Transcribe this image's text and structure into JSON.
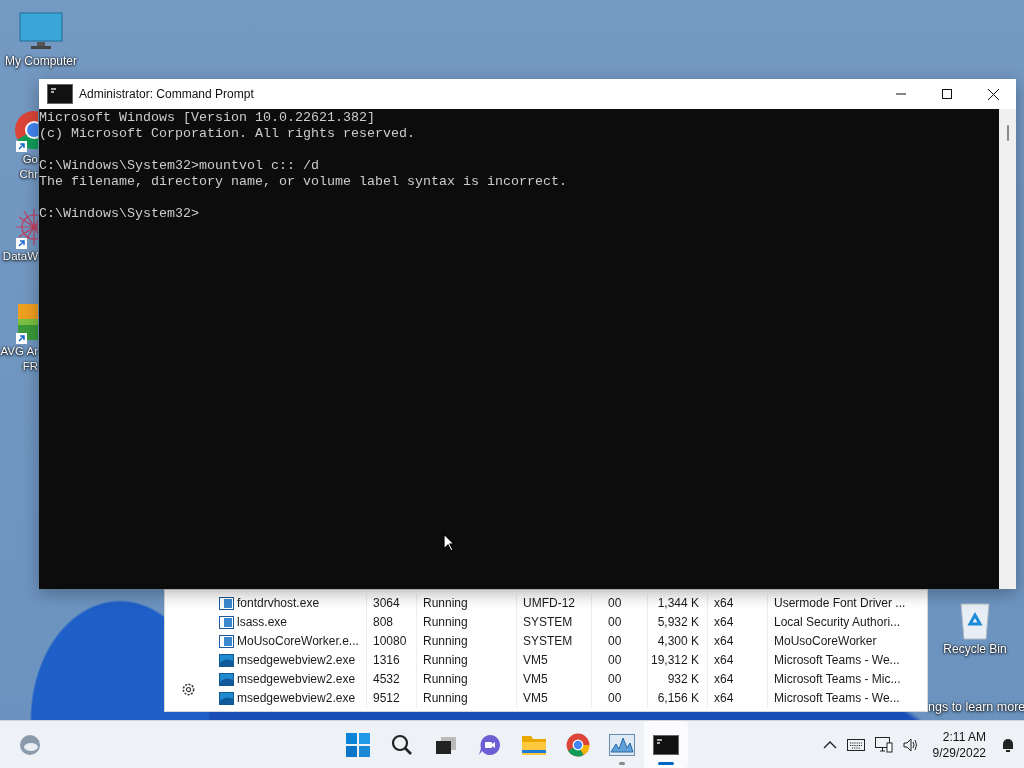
{
  "desktop_icons": [
    {
      "kind": "computer",
      "label_lines": [
        "My Computer"
      ],
      "shortcut": false
    },
    {
      "kind": "chrome",
      "label_lines": [
        "Go",
        "Chr"
      ],
      "shortcut": true
    },
    {
      "kind": "network",
      "label_lines": [
        "DataW"
      ],
      "shortcut": true
    },
    {
      "kind": "avg",
      "label_lines": [
        "AVG Ar",
        "FR"
      ],
      "shortcut": true
    }
  ],
  "recycle_bin": {
    "label": "Recycle Bin"
  },
  "activation_text": "ngs to learn more",
  "task_manager": {
    "rows": [
      {
        "kind": "service",
        "name": "fontdrvhost.exe",
        "pid": "3064",
        "status": "Running",
        "user": "UMFD-12",
        "cpu": "00",
        "memory": "1,344 K",
        "arch": "x64",
        "description": "Usermode Font Driver ..."
      },
      {
        "kind": "service",
        "name": "lsass.exe",
        "pid": "808",
        "status": "Running",
        "user": "SYSTEM",
        "cpu": "00",
        "memory": "5,932 K",
        "arch": "x64",
        "description": "Local Security Authori..."
      },
      {
        "kind": "service",
        "name": "MoUsoCoreWorker.e...",
        "pid": "10080",
        "status": "Running",
        "user": "SYSTEM",
        "cpu": "00",
        "memory": "4,300 K",
        "arch": "x64",
        "description": "MoUsoCoreWorker"
      },
      {
        "kind": "webview",
        "name": "msedgewebview2.exe",
        "pid": "1316",
        "status": "Running",
        "user": "VM5",
        "cpu": "00",
        "memory": "19,312 K",
        "arch": "x64",
        "description": "Microsoft Teams - We..."
      },
      {
        "kind": "webview",
        "name": "msedgewebview2.exe",
        "pid": "4532",
        "status": "Running",
        "user": "VM5",
        "cpu": "00",
        "memory": "932 K",
        "arch": "x64",
        "description": "Microsoft Teams - Mic..."
      },
      {
        "kind": "webview",
        "name": "msedgewebview2.exe",
        "pid": "9512",
        "status": "Running",
        "user": "VM5",
        "cpu": "00",
        "memory": "6,156 K",
        "arch": "x64",
        "description": "Microsoft Teams - We..."
      }
    ]
  },
  "console_window": {
    "title": "Administrator: Command Prompt",
    "blocks": [
      [
        "Microsoft Windows [Version 10.0.22621.382]",
        "(c) Microsoft Corporation. All rights reserved."
      ],
      [
        "C:\\Windows\\System32>mountvol c:: /d",
        "The filename, directory name, or volume label syntax is incorrect."
      ],
      [
        "C:\\Windows\\System32>"
      ]
    ]
  },
  "taskbar": {
    "apps": [
      {
        "kind": "start",
        "running": false,
        "selected": false
      },
      {
        "kind": "search",
        "running": false,
        "selected": false
      },
      {
        "kind": "taskview",
        "running": false,
        "selected": false
      },
      {
        "kind": "chat",
        "running": false,
        "selected": false
      },
      {
        "kind": "explorer",
        "running": false,
        "selected": false
      },
      {
        "kind": "chrome",
        "running": false,
        "selected": false
      },
      {
        "kind": "taskmanager",
        "running": true,
        "selected": false
      },
      {
        "kind": "console",
        "running": true,
        "selected": true
      }
    ],
    "time": "2:11 AM",
    "date": "9/29/2022"
  }
}
